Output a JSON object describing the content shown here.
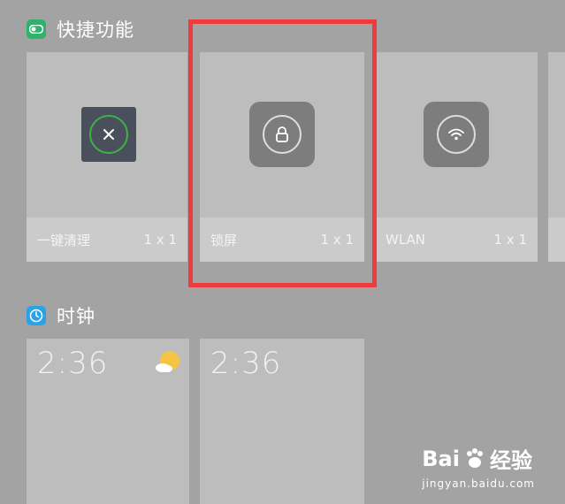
{
  "sections": {
    "quick": {
      "title": "快捷功能"
    },
    "clock": {
      "title": "时钟"
    }
  },
  "quick_tiles": [
    {
      "label": "一键清理",
      "size": "1 x 1",
      "icon": "close-icon"
    },
    {
      "label": "锁屏",
      "size": "1 x 1",
      "icon": "lock-icon"
    },
    {
      "label": "WLAN",
      "size": "1 x 1",
      "icon": "wifi-icon"
    }
  ],
  "clock_tiles": [
    {
      "time": "2:36",
      "icon": "weather-sun-cloud-icon"
    },
    {
      "time": "2:36"
    }
  ],
  "watermark": {
    "brand_left": "Bai",
    "brand_right": "经验",
    "url": "jingyan.baidu.com"
  },
  "colors": {
    "background": "#a3a3a3",
    "tile": "#bdbdbd",
    "highlight": "#ee3b3b",
    "quick_icon": "#2fb36b",
    "clock_icon": "#2aa3e6"
  }
}
